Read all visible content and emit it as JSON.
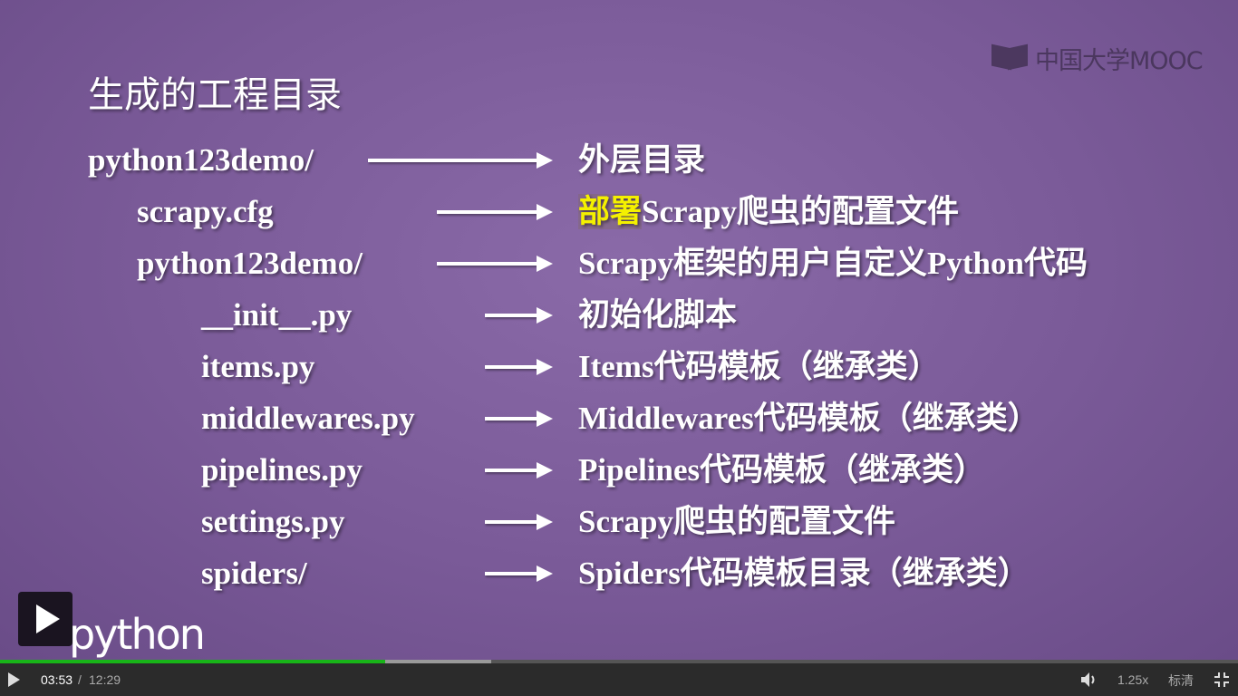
{
  "slide": {
    "title": "生成的工程目录",
    "logo_text": "中国大学MOOC",
    "python_logo_text": "python",
    "rows": [
      {
        "name": "python123demo/",
        "desc": "外层目录",
        "desc_highlight": ""
      },
      {
        "name": "scrapy.cfg",
        "desc": "Scrapy爬虫的配置文件",
        "desc_highlight": "部署"
      },
      {
        "name": "python123demo/",
        "desc": "Scrapy框架的用户自定义Python代码",
        "desc_highlight": ""
      },
      {
        "name": "__init__.py",
        "desc": "初始化脚本",
        "desc_highlight": ""
      },
      {
        "name": "items.py",
        "desc": "Items代码模板（继承类）",
        "desc_highlight": ""
      },
      {
        "name": "middlewares.py",
        "desc": "Middlewares代码模板（继承类）",
        "desc_highlight": ""
      },
      {
        "name": "pipelines.py",
        "desc": "Pipelines代码模板（继承类）",
        "desc_highlight": ""
      },
      {
        "name": "settings.py",
        "desc": "Scrapy爬虫的配置文件",
        "desc_highlight": ""
      },
      {
        "name": "spiders/",
        "desc": "Spiders代码模板目录（继承类）",
        "desc_highlight": ""
      }
    ],
    "highlight_color": "#f4f000"
  },
  "player": {
    "current_time": "03:53",
    "separator": "/",
    "duration": "12:29",
    "played_fraction": 0.311,
    "buffered_fraction": 0.397,
    "speed": "1.25x",
    "quality": "标清",
    "colors": {
      "progress_played": "#18b418",
      "progress_buffered": "#9a9a9a",
      "bar_bg": "#2b2b2b"
    }
  }
}
